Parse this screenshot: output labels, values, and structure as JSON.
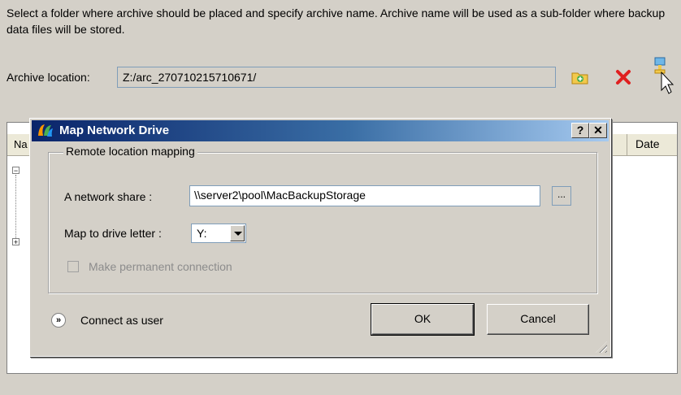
{
  "description": "Select a folder where archive should be placed and specify archive name. Archive name will be used as a sub-folder where backup data files will be stored.",
  "archive": {
    "label": "Archive location:",
    "value": "Z:/arc_270710215710671/"
  },
  "toolbar_icons": [
    "new-folder-icon",
    "delete-icon",
    "map-network-drive-icon"
  ],
  "list": {
    "header_name": "Na",
    "header_date": "Date"
  },
  "dialog": {
    "title": "Map Network Drive",
    "help_label": "?",
    "close_label": "✕",
    "group_title": "Remote location mapping",
    "share_label": "A network share   :",
    "share_value": "\\\\server2\\pool\\MacBackupStorage",
    "browse_label": "...",
    "drive_label": "Map to drive letter :",
    "drive_value": "Y:",
    "permanent_label": "Make permanent connection",
    "permanent_checked": false,
    "connect_label": "Connect as user",
    "ok_label": "OK",
    "cancel_label": "Cancel"
  },
  "colors": {
    "titlebar_start": "#0a246a",
    "titlebar_end": "#a6caf0",
    "face": "#d4d0c8"
  }
}
